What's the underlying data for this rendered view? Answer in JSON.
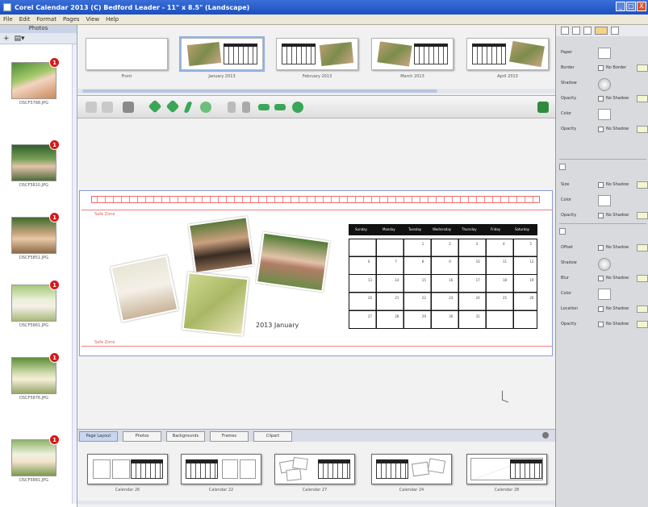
{
  "window": {
    "title": "Corel Calendar 2013 (C) Bedford Leader - 11\" x 8.5\" (Landscape)",
    "buttons": [
      "_",
      "□",
      "X"
    ]
  },
  "menu": [
    "File",
    "Edit",
    "Format",
    "Pages",
    "View",
    "Help"
  ],
  "left_panel": {
    "header": "Photos",
    "tools": [
      "+",
      "▤▾"
    ],
    "photos": [
      {
        "caption": "DSCF5788.JPG",
        "badge": "1"
      },
      {
        "caption": "DSCF5810.JPG",
        "badge": "1"
      },
      {
        "caption": "DSCF5851.JPG",
        "badge": "1"
      },
      {
        "caption": "DSCF5861.JPG",
        "badge": "1"
      },
      {
        "caption": "DSCF5876.JPG",
        "badge": "1"
      },
      {
        "caption": "DSCF5881.JPG",
        "badge": "1"
      }
    ]
  },
  "page_strip": {
    "pages": [
      {
        "label": "Front"
      },
      {
        "label": "January 2013"
      },
      {
        "label": "February 2013"
      },
      {
        "label": "March 2013"
      },
      {
        "label": "April 2013"
      }
    ]
  },
  "canvas": {
    "safe_zone_label": "Safe Zone",
    "bleed_label": "Safe Zone",
    "month_label": "2013  January",
    "calendar_header": [
      "Sunday",
      "Monday",
      "Tuesday",
      "Wednesday",
      "Thursday",
      "Friday",
      "Saturday"
    ],
    "calendar_rows": [
      [
        "",
        "",
        "1",
        "2",
        "3",
        "4",
        "5"
      ],
      [
        "6",
        "7",
        "8",
        "9",
        "10",
        "11",
        "12"
      ],
      [
        "13",
        "14",
        "15",
        "16",
        "17",
        "18",
        "19"
      ],
      [
        "20",
        "21",
        "22",
        "23",
        "24",
        "25",
        "26"
      ],
      [
        "27",
        "28",
        "29",
        "30",
        "31",
        "",
        ""
      ]
    ]
  },
  "bottom_tabs": [
    "Page Layout",
    "Photos",
    "Backgrounds",
    "Frames",
    "Clipart"
  ],
  "layouts": [
    {
      "label": "Calendar 26"
    },
    {
      "label": "Calendar 22"
    },
    {
      "label": "Calendar 27"
    },
    {
      "label": "Calendar 24"
    },
    {
      "label": "Calendar 28"
    }
  ],
  "right_panel": {
    "rows": [
      {
        "label": "Paper",
        "type": "swatch"
      },
      {
        "label": "Border",
        "type": "check",
        "check_label": "No Border"
      },
      {
        "label": "Shadow",
        "type": "drop"
      },
      {
        "label": "Opacity",
        "type": "check",
        "check_label": "No Shadow"
      },
      {
        "label": "Color",
        "type": "swatch"
      },
      {
        "label": "Opacity",
        "type": "check",
        "check_label": "No Shadow"
      }
    ],
    "rows2": [
      {
        "label": "Size",
        "type": "check",
        "check_label": "No Shadow"
      },
      {
        "label": "Color",
        "type": "swatch"
      },
      {
        "label": "Opacity",
        "type": "check",
        "check_label": "No Shadow"
      }
    ],
    "rows3": [
      {
        "label": "Offset",
        "type": "check",
        "check_label": "No Shadow"
      },
      {
        "label": "Shadow",
        "type": "drop"
      },
      {
        "label": "Blur",
        "type": "check",
        "check_label": "No Shadow"
      },
      {
        "label": "Color",
        "type": "swatch"
      },
      {
        "label": "Location",
        "type": "check",
        "check_label": "No Shadow"
      },
      {
        "label": "Opacity",
        "type": "check",
        "check_label": "No Shadow"
      }
    ]
  },
  "colors": {
    "title_bar": "#1c4fc0",
    "badge": "#d81818",
    "safe_zone": "#f08080",
    "page_border": "#8b9bd8",
    "toolbar_green": "#3aa657"
  }
}
